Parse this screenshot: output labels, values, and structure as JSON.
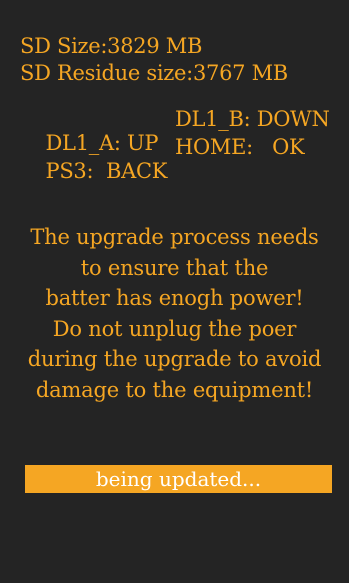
{
  "sd_info": {
    "size": "SD Size:3829 MB",
    "residue": "SD Residue size:3767 MB"
  },
  "key_map": {
    "row1": {
      "a": "DL1_A: UP",
      "b": "DL1_B: DOWN"
    },
    "row2": {
      "a": "PS3:  BACK",
      "b": "HOME:   OK"
    }
  },
  "warning_lines": [
    "The upgrade process needs",
    "to ensure that the",
    "batter has enogh power!",
    "Do not unplug the poer",
    "during the upgrade to avoid",
    "damage to the equipment!"
  ],
  "progress": {
    "label": "being updated...",
    "accent_color": "#f5a623"
  }
}
